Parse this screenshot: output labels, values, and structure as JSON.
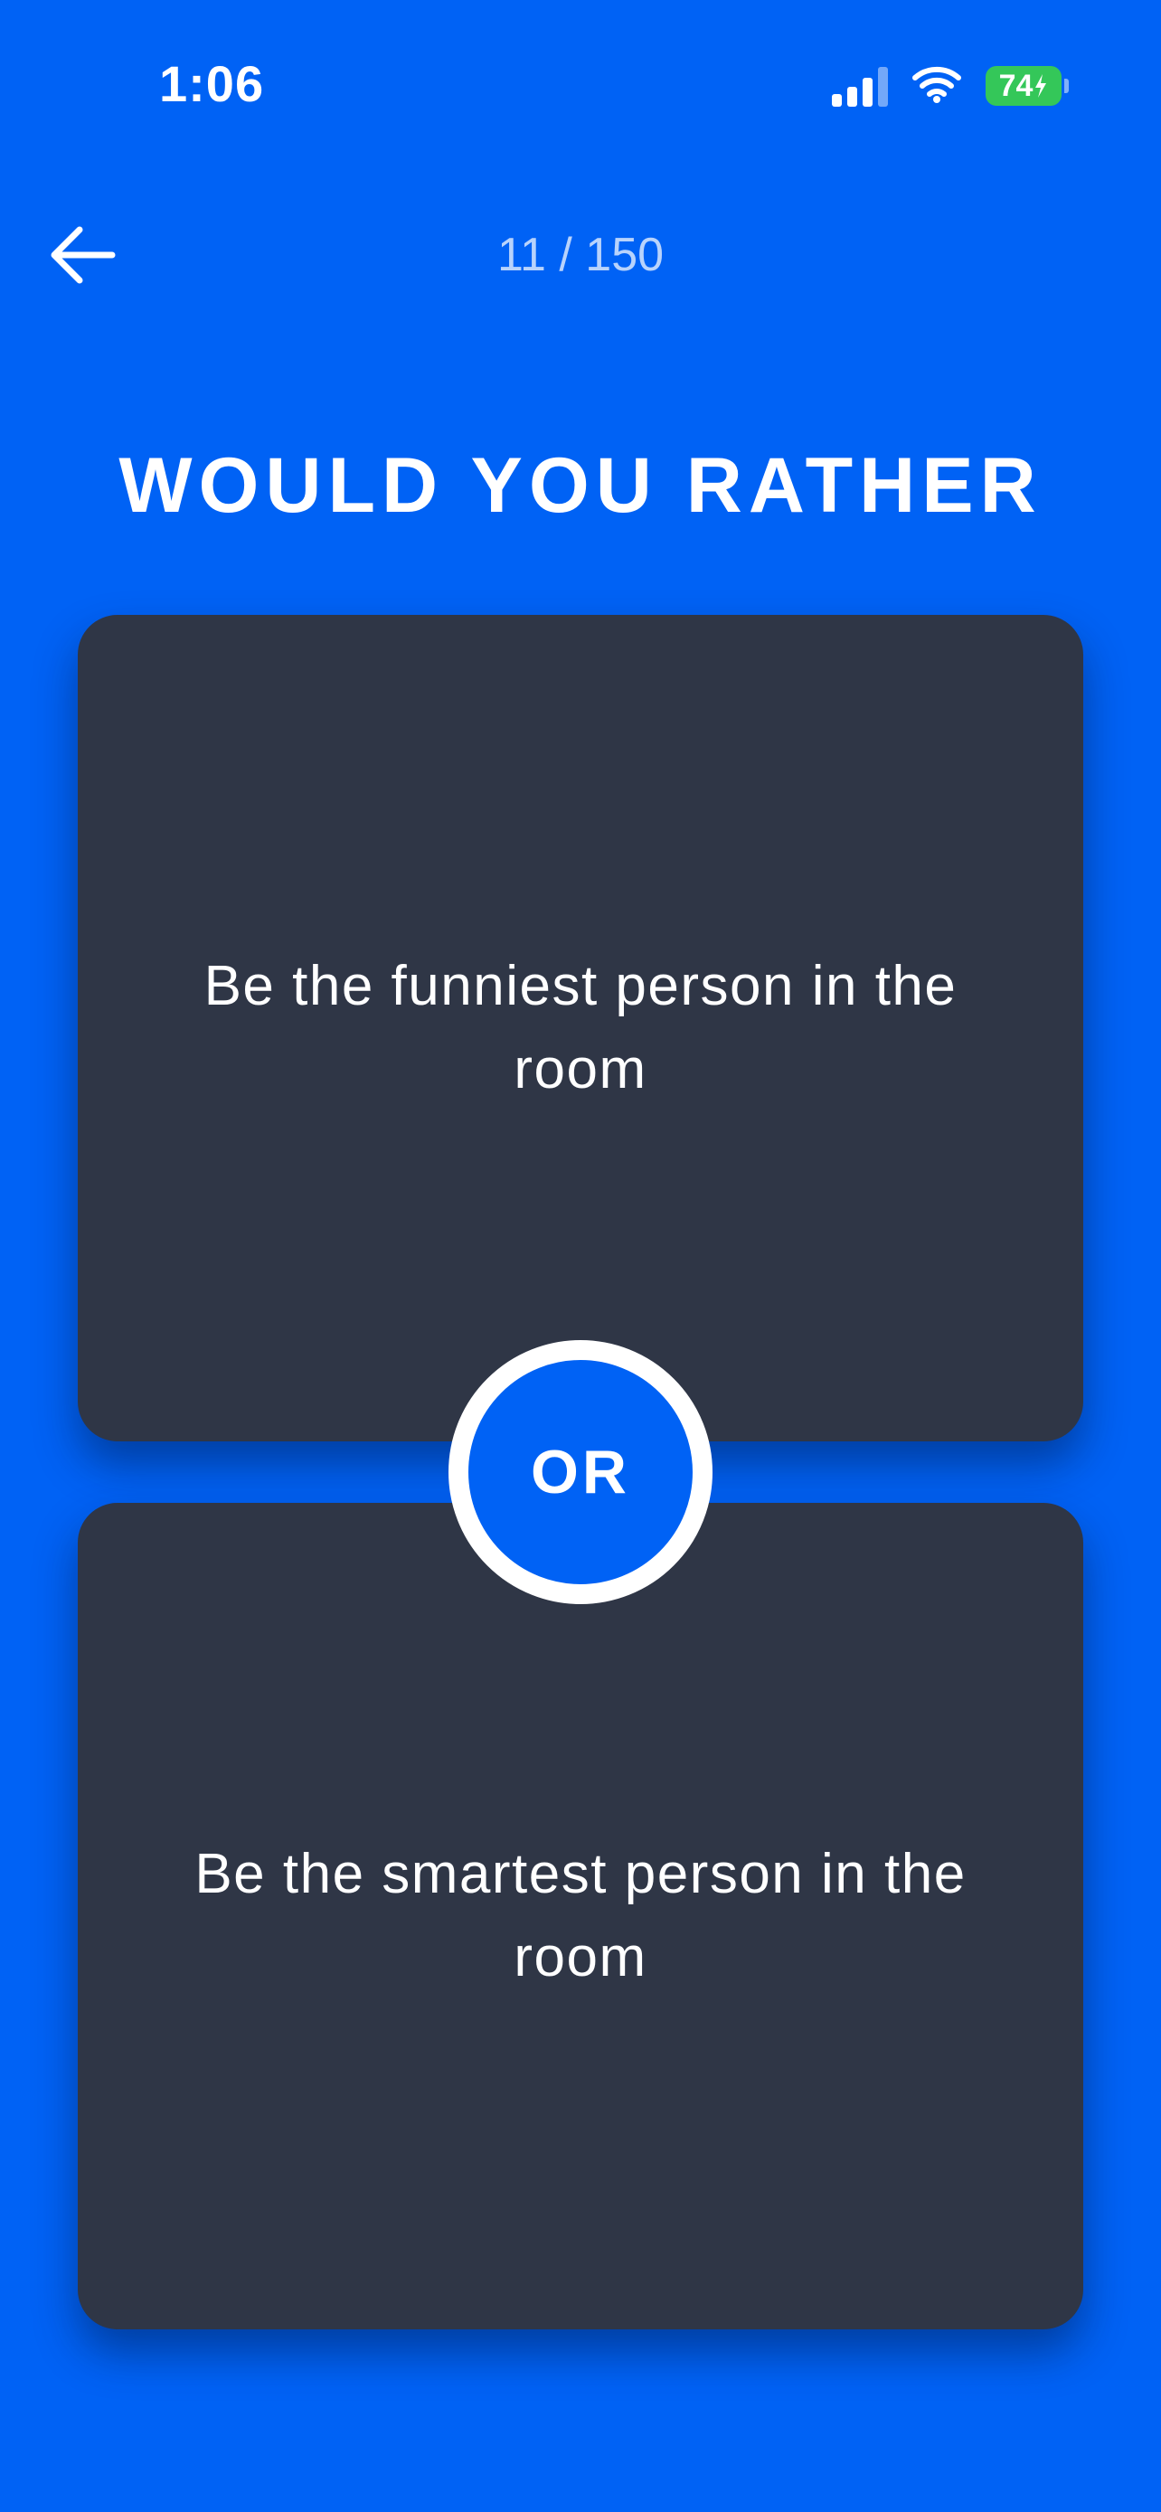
{
  "status_bar": {
    "time": "1:06",
    "battery_level": "74",
    "icons": [
      "signal-icon",
      "wifi-icon",
      "battery-charging-icon"
    ]
  },
  "nav": {
    "back_icon": "arrow-left-icon",
    "progress": "11 / 150"
  },
  "title": "WOULD YOU RATHER",
  "options": [
    {
      "text": "Be the funniest person in the room"
    },
    {
      "text": "Be the smartest person in the room"
    }
  ],
  "divider_label": "OR",
  "colors": {
    "background": "#0062f5",
    "card": "#2f3646",
    "battery": "#34c759",
    "text": "#ffffff"
  }
}
